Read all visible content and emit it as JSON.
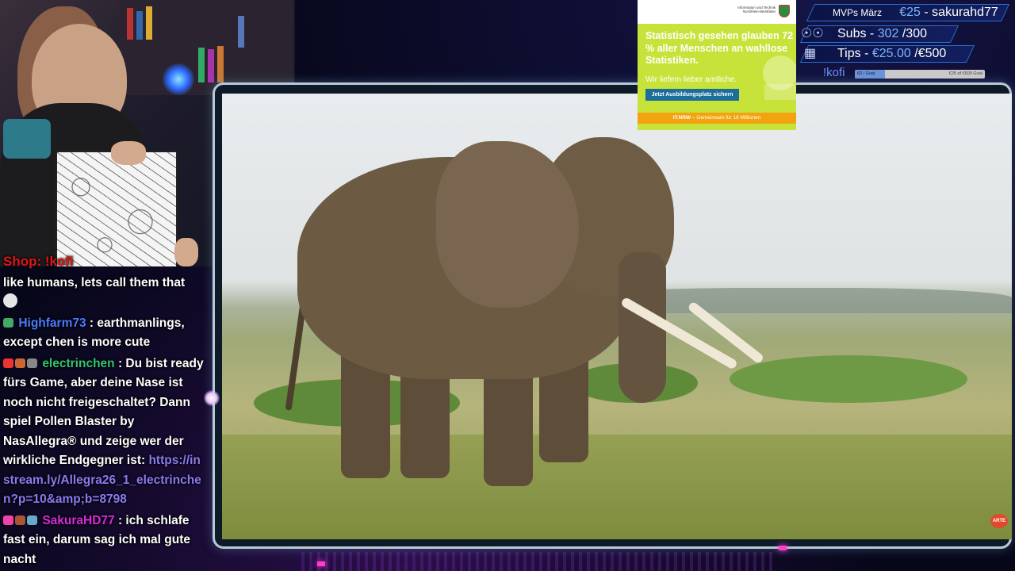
{
  "stats": {
    "mvps_label": "MVPs März",
    "mvps_value": "€25",
    "mvps_user": "- sakurahd77",
    "subs_label": "Subs -",
    "subs_current": "302",
    "subs_goal": "/300",
    "tips_label": "Tips -",
    "tips_current": "€25.00",
    "tips_goal": "/€500",
    "kofi_label": "!kofi",
    "kofi_bar_left": "€0 / Goal",
    "kofi_bar_right": "€25 of €500 Goal",
    "kofi_progress": 0.23,
    "icons": {
      "subs": "users-icon",
      "tips": "coins-icon"
    }
  },
  "ad": {
    "headline": "Statistisch gesehen glauben 72 % aller Menschen an wahllose Statistiken.",
    "subline": "Wir liefern lieber amtliche.",
    "cta": "Jetzt Ausbildungsplatz sichern",
    "footer_brand": "IT.NRW –",
    "footer_text": "Gemeinsam für 18 Millionen",
    "logo_text": "Information und Technik Nordrhein-Westfalen"
  },
  "chat": {
    "shop": "Shop: !kofi",
    "messages": [
      {
        "text": "like humans, lets call them that"
      },
      {
        "user": "Highfarm73",
        "text": ": earthmanlings, except chen is more cute"
      },
      {
        "user": "electrinchen",
        "text": ": Du bist ready fürs Game, aber deine Nase ist noch nicht freigeschaltet?",
        "text2": "Dann spiel Pollen Blaster by NasAllegra® und zeige wer der wirkliche Endgegner ist:",
        "link": "https://instream.ly/Allegra26_1_electrinchen?p=10&amp;b=8798"
      },
      {
        "user": "SakuraHD77",
        "text": ": ich schlafe fast ein, darum sag ich mal gute nacht"
      }
    ]
  },
  "video": {
    "badge": "ARTE"
  },
  "colors": {
    "accent_blue": "#2d6fd6",
    "ad_green": "#c7e33a",
    "ad_orange": "#f2a30f",
    "shop_red": "#e01616"
  }
}
